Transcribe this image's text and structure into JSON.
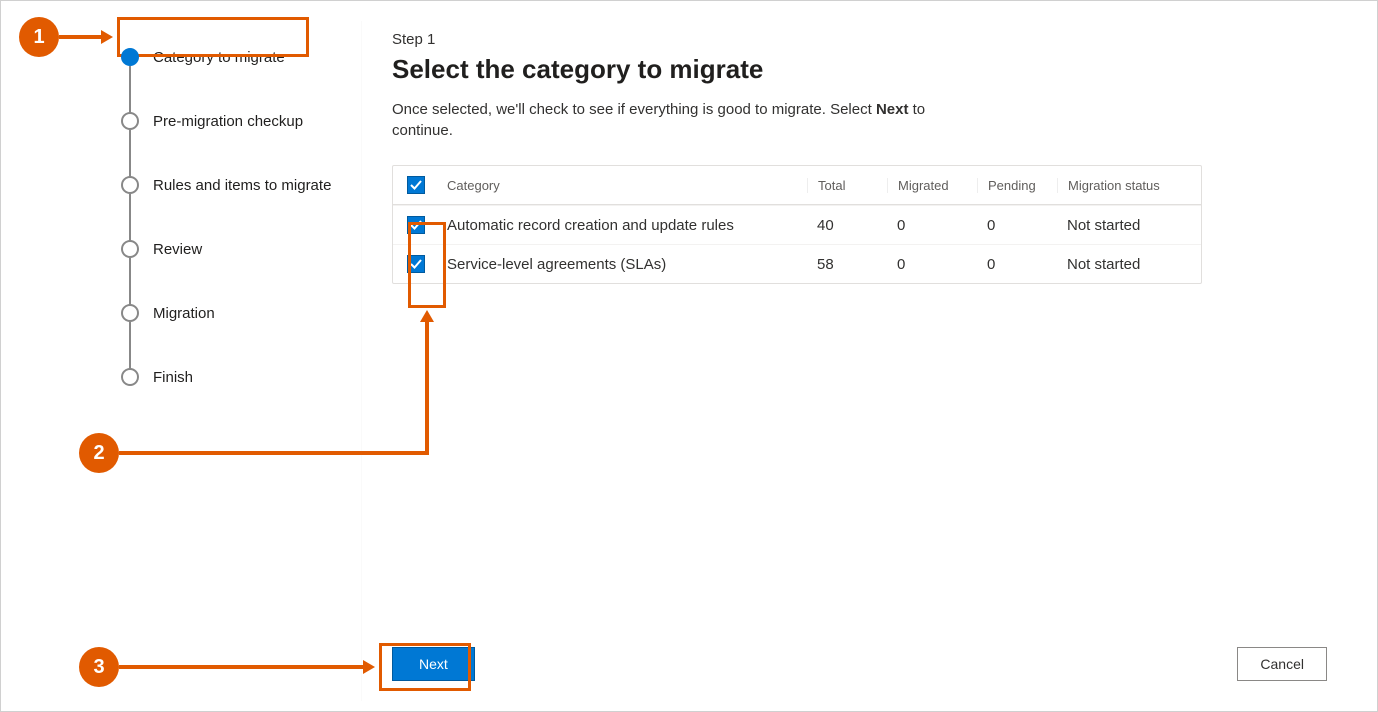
{
  "stepper": {
    "steps": [
      {
        "label": "Category to migrate",
        "active": true
      },
      {
        "label": "Pre-migration checkup",
        "active": false
      },
      {
        "label": "Rules and items to migrate",
        "active": false
      },
      {
        "label": "Review",
        "active": false
      },
      {
        "label": "Migration",
        "active": false
      },
      {
        "label": "Finish",
        "active": false
      }
    ]
  },
  "main": {
    "eyebrow": "Step 1",
    "title": "Select the category to migrate",
    "desc_pre": "Once selected, we'll check to see if everything is good to migrate. Select ",
    "desc_bold": "Next",
    "desc_post": " to continue."
  },
  "table": {
    "headers": {
      "category": "Category",
      "total": "Total",
      "migrated": "Migrated",
      "pending": "Pending",
      "status": "Migration status"
    },
    "rows": [
      {
        "name": "Automatic record creation and update rules",
        "total": "40",
        "migrated": "0",
        "pending": "0",
        "status": "Not started",
        "checked": true
      },
      {
        "name": "Service-level agreements (SLAs)",
        "total": "58",
        "migrated": "0",
        "pending": "0",
        "status": "Not started",
        "checked": true
      }
    ]
  },
  "footer": {
    "next": "Next",
    "cancel": "Cancel"
  },
  "callouts": {
    "c1": "1",
    "c2": "2",
    "c3": "3"
  }
}
